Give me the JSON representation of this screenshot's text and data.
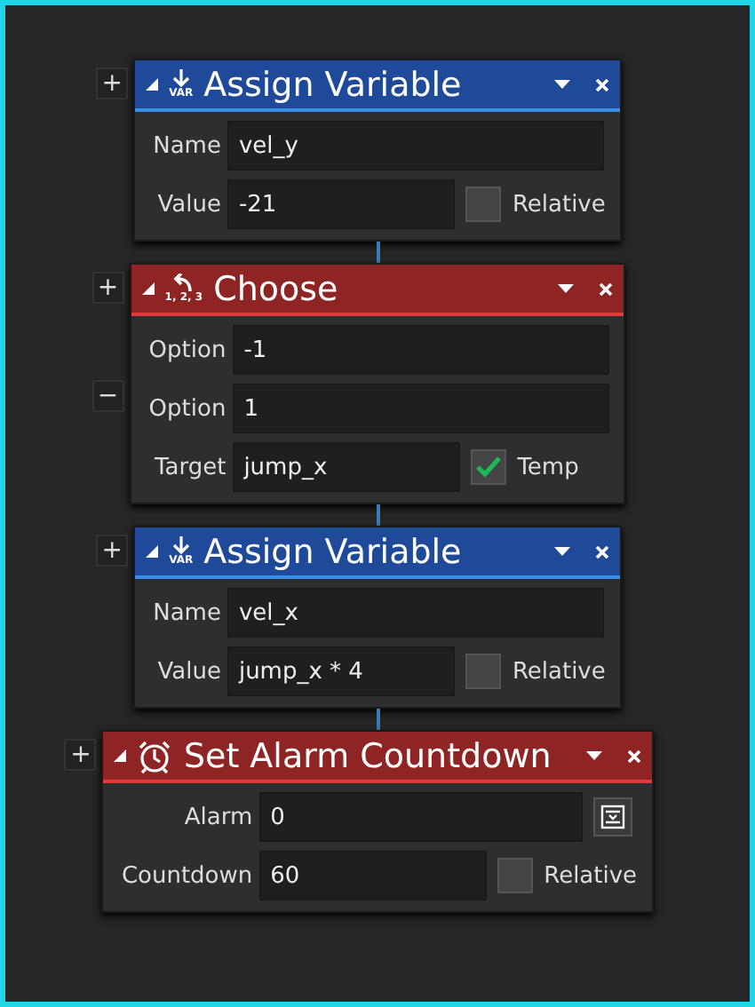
{
  "blocks": [
    {
      "title": "Assign Variable",
      "kind": "var",
      "icon_text": "VAR",
      "color": "#1f4a99",
      "side": "+",
      "rows": [
        {
          "label": "Name",
          "value": "vel_y",
          "kind": "text"
        },
        {
          "label": "Value",
          "value": "-21",
          "kind": "text",
          "checkbox": {
            "label": "Relative",
            "checked": false
          }
        }
      ]
    },
    {
      "title": "Choose",
      "kind": "choose",
      "icon_text": "1, 2, 3",
      "color": "#8e2424",
      "side": "+",
      "rows": [
        {
          "label": "Option",
          "value": "-1",
          "kind": "text"
        },
        {
          "label": "Option",
          "value": "1",
          "kind": "text",
          "side": "−"
        },
        {
          "label": "Target",
          "value": "jump_x",
          "kind": "text",
          "checkbox": {
            "label": "Temp",
            "checked": true
          }
        }
      ]
    },
    {
      "title": "Assign Variable",
      "kind": "var",
      "icon_text": "VAR",
      "color": "#1f4a99",
      "side": "+",
      "rows": [
        {
          "label": "Name",
          "value": "vel_x",
          "kind": "text"
        },
        {
          "label": "Value",
          "value": "jump_x * 4",
          "kind": "text",
          "checkbox": {
            "label": "Relative",
            "checked": false
          }
        }
      ]
    },
    {
      "title": "Set Alarm Countdown",
      "kind": "alarm",
      "color": "#8e2424",
      "side": "+",
      "rows": [
        {
          "label": "Alarm",
          "value": "0",
          "kind": "menu"
        },
        {
          "label": "Countdown",
          "value": "60",
          "kind": "text",
          "checkbox": {
            "label": "Relative",
            "checked": false
          }
        }
      ]
    }
  ]
}
